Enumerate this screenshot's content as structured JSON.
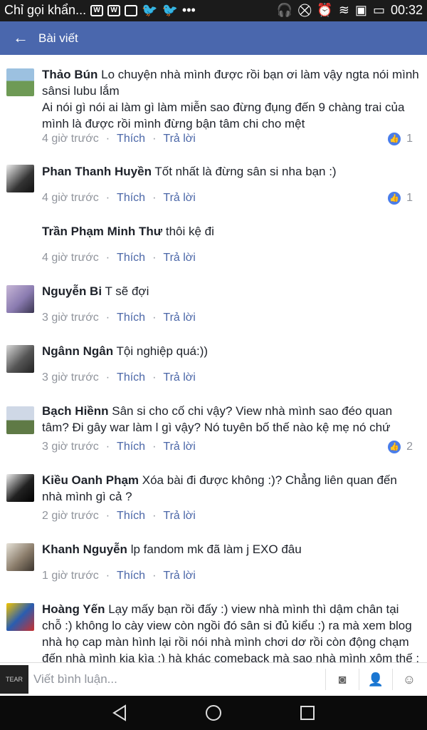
{
  "status_bar": {
    "notification": "Chỉ gọi khẩn...",
    "time": "00:32"
  },
  "app_bar": {
    "title": "Bài viết"
  },
  "comments": [
    {
      "name": "Thảo Bún",
      "text": "Lo chuyện nhà mình được rồi bạn ơi làm vậy ngta nói mình sânsi lubu lắm",
      "text2": "Ai nói gì nói ai làm gì làm miễn sao đừng đụng đến 9 chàng trai của mình là được rồi mình đừng bận tâm chi cho mệt",
      "time": "4 giờ trước",
      "like": "Thích",
      "reply": "Trả lời",
      "likes": "1"
    },
    {
      "name": "Phan Thanh Huyền",
      "text": "Tốt nhất là đừng sân si nha bạn :)",
      "time": "4 giờ trước",
      "like": "Thích",
      "reply": "Trả lời",
      "likes": "1"
    },
    {
      "name": "Trần Phạm Minh Thư",
      "text": "thôi kệ đi",
      "time": "4 giờ trước",
      "like": "Thích",
      "reply": "Trả lời"
    },
    {
      "name": "Nguyễn Bi",
      "text": "T sẽ đợi",
      "time": "3 giờ trước",
      "like": "Thích",
      "reply": "Trả lời"
    },
    {
      "name": "Ngânn Ngân",
      "text": "Tội nghiệp quá:))",
      "time": "3 giờ trước",
      "like": "Thích",
      "reply": "Trả lời"
    },
    {
      "name": "Bạch Hiềnn",
      "text": "Sân si cho cố chi vậy? View nhà mình sao đéo quan tâm? Đi gây war làm l gì vậy? Nó tuyên bố thế nào kệ mẹ nó chứ",
      "time": "3 giờ trước",
      "like": "Thích",
      "reply": "Trả lời",
      "likes": "2"
    },
    {
      "name": "Kiều Oanh Phạm",
      "text": "Xóa bài đi được không :)? Chẳng liên quan đến nhà mình gì cả ?",
      "time": "2 giờ trước",
      "like": "Thích",
      "reply": "Trả lời"
    },
    {
      "name": "Khanh Nguyễn",
      "text": "lp fandom mk đã làm j EXO đâu",
      "time": "1 giờ trước",
      "like": "Thích",
      "reply": "Trả lời"
    },
    {
      "name": "Hoàng Yến",
      "text": "Lạy mấy bạn rồi đấy :) view nhà mình thì dậm chân tại chỗ :) không lo cày view còn ngồi đó sân si đủ kiểu :) ra mà xem blog nhà họ cap màn hình lại rồi nói nhà mình chơi dơ rồi còn động chạm đến nhà mình kia kìa :) hà khác comeback mà sao nhà mình xôm thế :"
    }
  ],
  "composer": {
    "placeholder": "Viết bình luận...",
    "avatar_text": "TEAR"
  },
  "colors": {
    "appbar": "#4a67ad",
    "link": "#4b67a8",
    "meta": "#90949c"
  }
}
